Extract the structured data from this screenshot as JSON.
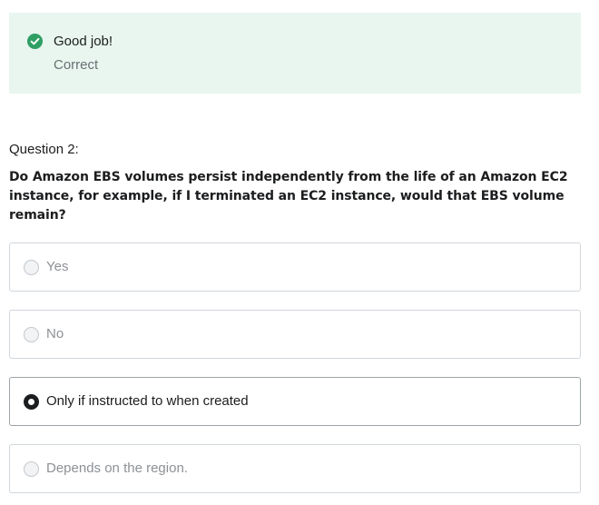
{
  "feedback": {
    "icon": "check-circle-icon",
    "color": "#2f9e63",
    "title": "Good job!",
    "subtitle": "Correct"
  },
  "question": {
    "number_label": "Question 2:",
    "text": "Do Amazon EBS volumes persist independently from the life of an Amazon EC2 instance, for example, if I terminated an EC2 instance, would that EBS volume remain?"
  },
  "options": [
    {
      "label": "Yes",
      "selected": false
    },
    {
      "label": "No",
      "selected": false
    },
    {
      "label": "Only if instructed to when created",
      "selected": true
    },
    {
      "label": "Depends on the region.",
      "selected": false
    }
  ]
}
